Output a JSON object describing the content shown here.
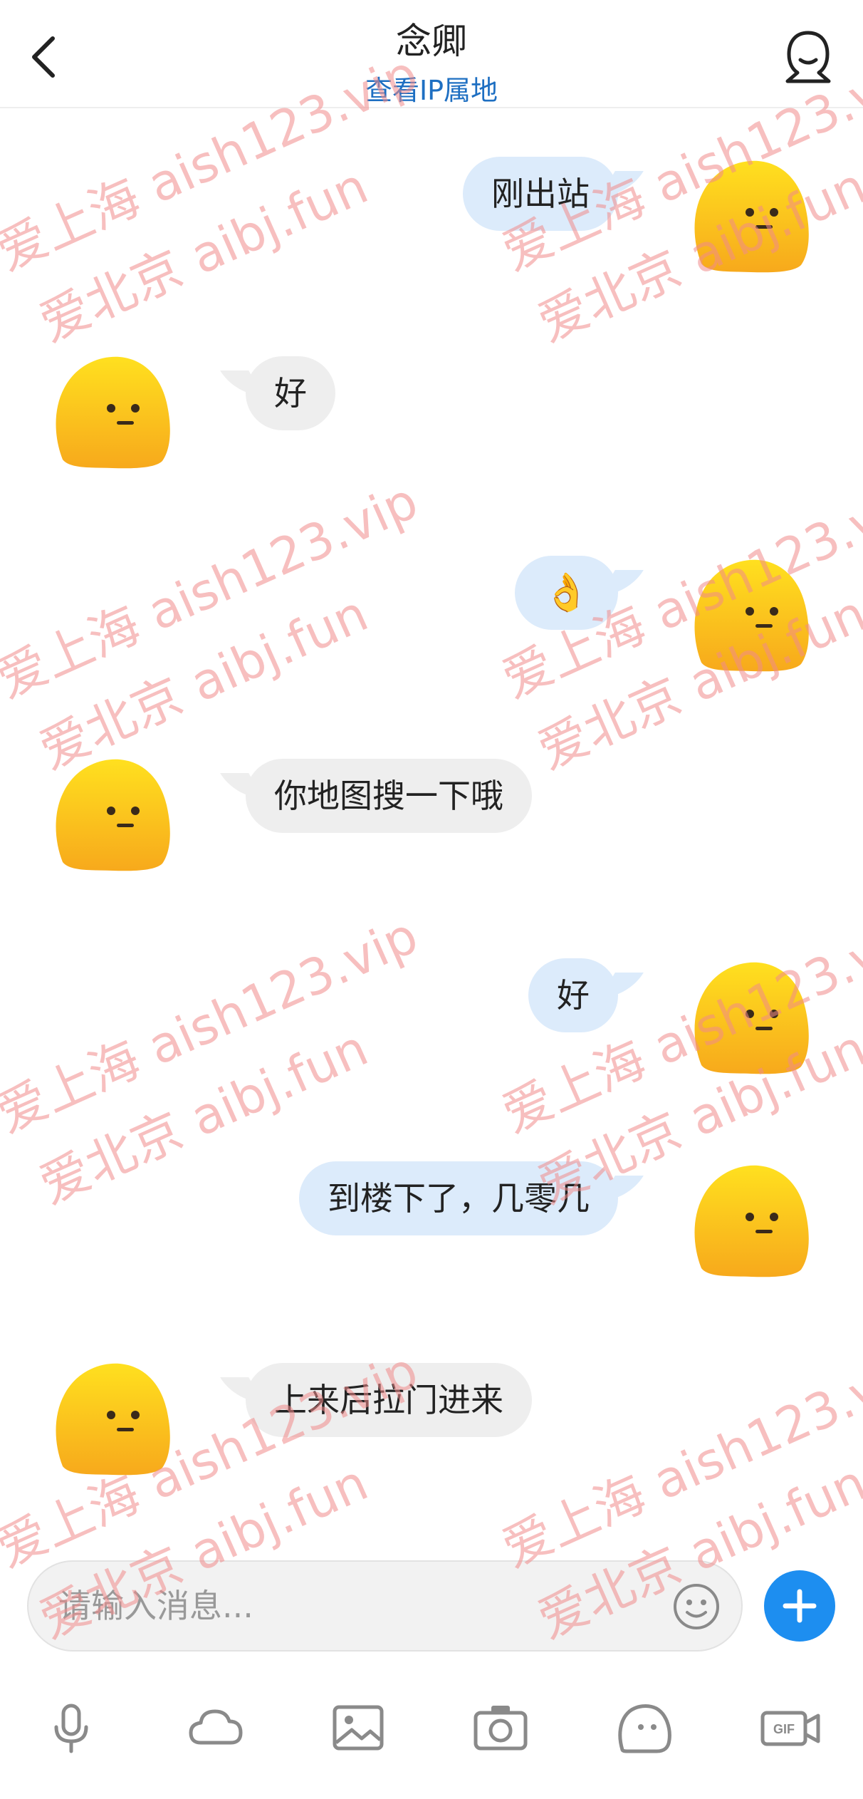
{
  "header": {
    "title": "念卿",
    "subtitle": "查看IP属地",
    "back_icon": "chevron-left-icon",
    "profile_icon": "profile-icon"
  },
  "messages": [
    {
      "direction": "out",
      "text": "刚出站"
    },
    {
      "direction": "in",
      "text": "好"
    },
    {
      "direction": "out",
      "text": "👌"
    },
    {
      "direction": "in",
      "text": "你地图搜一下哦"
    },
    {
      "direction": "out",
      "text": "好"
    },
    {
      "direction": "out",
      "text": "到楼下了，几零几"
    },
    {
      "direction": "in",
      "text": "上来后拉门进来"
    }
  ],
  "input": {
    "placeholder": "请输入消息...",
    "emoji_icon": "smiley-icon",
    "plus_icon": "plus-icon"
  },
  "toolbar": {
    "items": [
      "microphone-icon",
      "cloud-icon",
      "image-icon",
      "camera-icon",
      "sticker-icon",
      "gif-icon"
    ],
    "gif_label": "GIF"
  },
  "watermark": {
    "lines": [
      "爱上海 aish123.vip",
      "爱北京 aibj.fun"
    ]
  },
  "colors": {
    "accent": "#1d8ef0",
    "link": "#1e6fc2",
    "bubble_out": "#dcebfb",
    "bubble_in": "#eeeeee",
    "avatar_yellow": "#fcc419"
  }
}
